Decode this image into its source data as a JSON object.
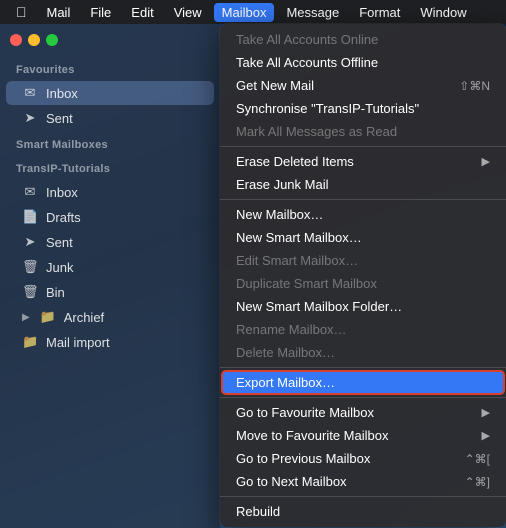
{
  "menubar": {
    "apple": "⌘",
    "items": [
      {
        "label": "Mail",
        "active": false
      },
      {
        "label": "File",
        "active": false
      },
      {
        "label": "Edit",
        "active": false
      },
      {
        "label": "View",
        "active": false
      },
      {
        "label": "Mailbox",
        "active": true
      },
      {
        "label": "Message",
        "active": false
      },
      {
        "label": "Format",
        "active": false
      },
      {
        "label": "Window",
        "active": false
      }
    ]
  },
  "sidebar": {
    "favourites_label": "Favourites",
    "smart_mailboxes_label": "Smart Mailboxes",
    "transip_label": "TransIP-Tutorials",
    "items_favourites": [
      {
        "icon": "✉",
        "label": "Inbox",
        "selected": true
      },
      {
        "icon": "➤",
        "label": "Sent",
        "selected": false
      }
    ],
    "items_transip": [
      {
        "icon": "✉",
        "label": "Inbox"
      },
      {
        "icon": "📄",
        "label": "Drafts"
      },
      {
        "icon": "➤",
        "label": "Sent"
      },
      {
        "icon": "🗑",
        "label": "Junk"
      },
      {
        "icon": "🗑",
        "label": "Bin"
      },
      {
        "icon": "📁",
        "label": "Archief",
        "has_arrow": true
      },
      {
        "icon": "📁",
        "label": "Mail import"
      }
    ]
  },
  "dropdown": {
    "items": [
      {
        "label": "Take All Accounts Online",
        "disabled": true,
        "shortcut": ""
      },
      {
        "label": "Take All Accounts Offline",
        "disabled": false,
        "shortcut": ""
      },
      {
        "label": "Get New Mail",
        "disabled": false,
        "shortcut": "⇧⌘N"
      },
      {
        "label": "Synchronise \"TransIP-Tutorials\"",
        "disabled": false,
        "shortcut": ""
      },
      {
        "label": "Mark All Messages as Read",
        "disabled": true,
        "shortcut": ""
      },
      {
        "separator": true
      },
      {
        "label": "Erase Deleted Items",
        "disabled": false,
        "shortcut": "",
        "has_submenu": true
      },
      {
        "label": "Erase Junk Mail",
        "disabled": false,
        "shortcut": ""
      },
      {
        "separator": true
      },
      {
        "label": "New Mailbox…",
        "disabled": false,
        "shortcut": ""
      },
      {
        "label": "New Smart Mailbox…",
        "disabled": false,
        "shortcut": ""
      },
      {
        "label": "Edit Smart Mailbox…",
        "disabled": true,
        "shortcut": ""
      },
      {
        "label": "Duplicate Smart Mailbox",
        "disabled": true,
        "shortcut": ""
      },
      {
        "label": "New Smart Mailbox Folder…",
        "disabled": false,
        "shortcut": ""
      },
      {
        "label": "Rename Mailbox…",
        "disabled": true,
        "shortcut": ""
      },
      {
        "label": "Delete Mailbox…",
        "disabled": true,
        "shortcut": ""
      },
      {
        "separator": true
      },
      {
        "label": "Export Mailbox…",
        "disabled": false,
        "shortcut": "",
        "highlighted": true
      },
      {
        "separator": true
      },
      {
        "label": "Go to Favourite Mailbox",
        "disabled": false,
        "shortcut": "",
        "has_submenu": true
      },
      {
        "label": "Move to Favourite Mailbox",
        "disabled": false,
        "shortcut": "",
        "has_submenu": true
      },
      {
        "label": "Go to Previous Mailbox",
        "disabled": false,
        "shortcut": "⌥⌘["
      },
      {
        "label": "Go to Next Mailbox",
        "disabled": false,
        "shortcut": "⌥⌘]"
      },
      {
        "separator": true
      },
      {
        "label": "Rebuild",
        "disabled": false,
        "shortcut": ""
      }
    ]
  }
}
